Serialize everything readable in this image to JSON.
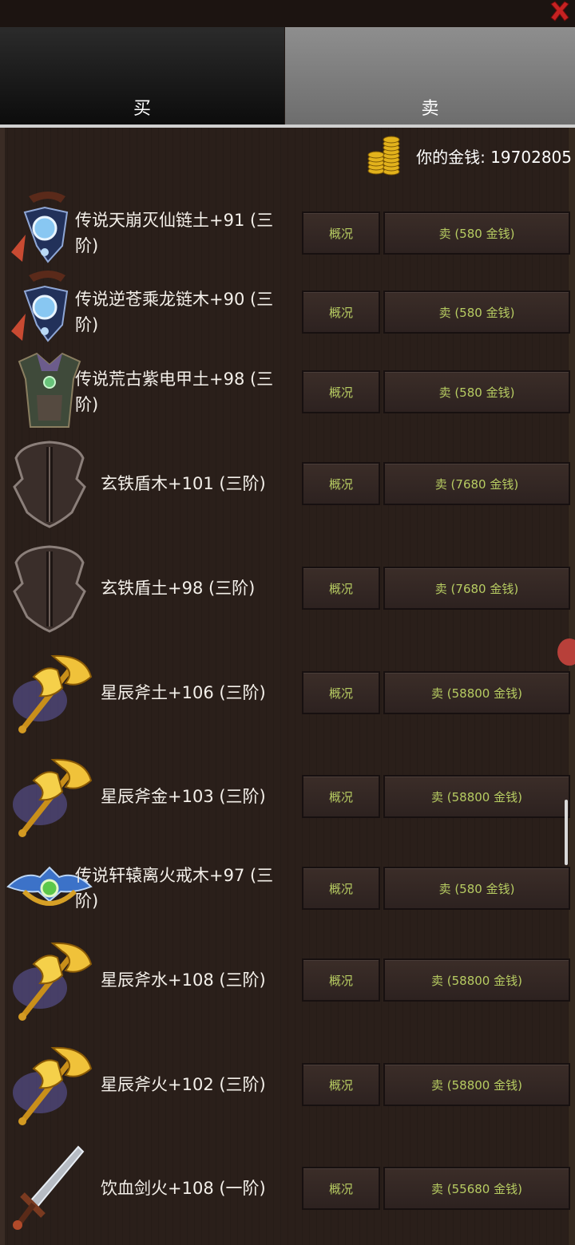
{
  "tabs": {
    "buy": "买",
    "sell": "卖",
    "active": "sell"
  },
  "money": {
    "label": "你的金钱:",
    "value": "19702805"
  },
  "items": [
    {
      "name_line1": "传说天崩灭仙链土+91 (三",
      "name_line2": "阶)",
      "icon": "necklace-icon",
      "info": "概况",
      "sell": "卖 (580 金钱)"
    },
    {
      "name_line1": "传说逆苍乘龙链木+90 (三",
      "name_line2": "阶)",
      "icon": "necklace-icon",
      "info": "概况",
      "sell": "卖 (580 金钱)"
    },
    {
      "name_line1": "传说荒古紫电甲土+98 (三",
      "name_line2": "阶)",
      "icon": "armor-icon",
      "info": "概况",
      "sell": "卖 (580 金钱)"
    },
    {
      "name_line1": "玄铁盾木+101 (三阶)",
      "name_line2": "",
      "icon": "shield-icon",
      "info": "概况",
      "sell": "卖 (7680 金钱)"
    },
    {
      "name_line1": "玄铁盾土+98 (三阶)",
      "name_line2": "",
      "icon": "shield-icon",
      "info": "概况",
      "sell": "卖 (7680 金钱)"
    },
    {
      "name_line1": "星辰斧土+106 (三阶)",
      "name_line2": "",
      "icon": "axe-icon",
      "info": "概况",
      "sell": "卖 (58800 金钱)"
    },
    {
      "name_line1": "星辰斧金+103 (三阶)",
      "name_line2": "",
      "icon": "axe-icon",
      "info": "概况",
      "sell": "卖 (58800 金钱)"
    },
    {
      "name_line1": "传说轩辕离火戒木+97 (三",
      "name_line2": "阶)",
      "icon": "ring-icon",
      "info": "概况",
      "sell": "卖 (580 金钱)"
    },
    {
      "name_line1": "星辰斧水+108 (三阶)",
      "name_line2": "",
      "icon": "axe-icon",
      "info": "概况",
      "sell": "卖 (58800 金钱)"
    },
    {
      "name_line1": "星辰斧火+102 (三阶)",
      "name_line2": "",
      "icon": "axe-icon",
      "info": "概况",
      "sell": "卖 (58800 金钱)"
    },
    {
      "name_line1": "饮血剑火+108 (一阶)",
      "name_line2": "",
      "icon": "sword-icon",
      "info": "概况",
      "sell": "卖 (55680 金钱)"
    }
  ],
  "colors": {
    "button_text": "#b7cc62",
    "background": "#2a1f1a",
    "active_tab": "#7d7d7d"
  }
}
